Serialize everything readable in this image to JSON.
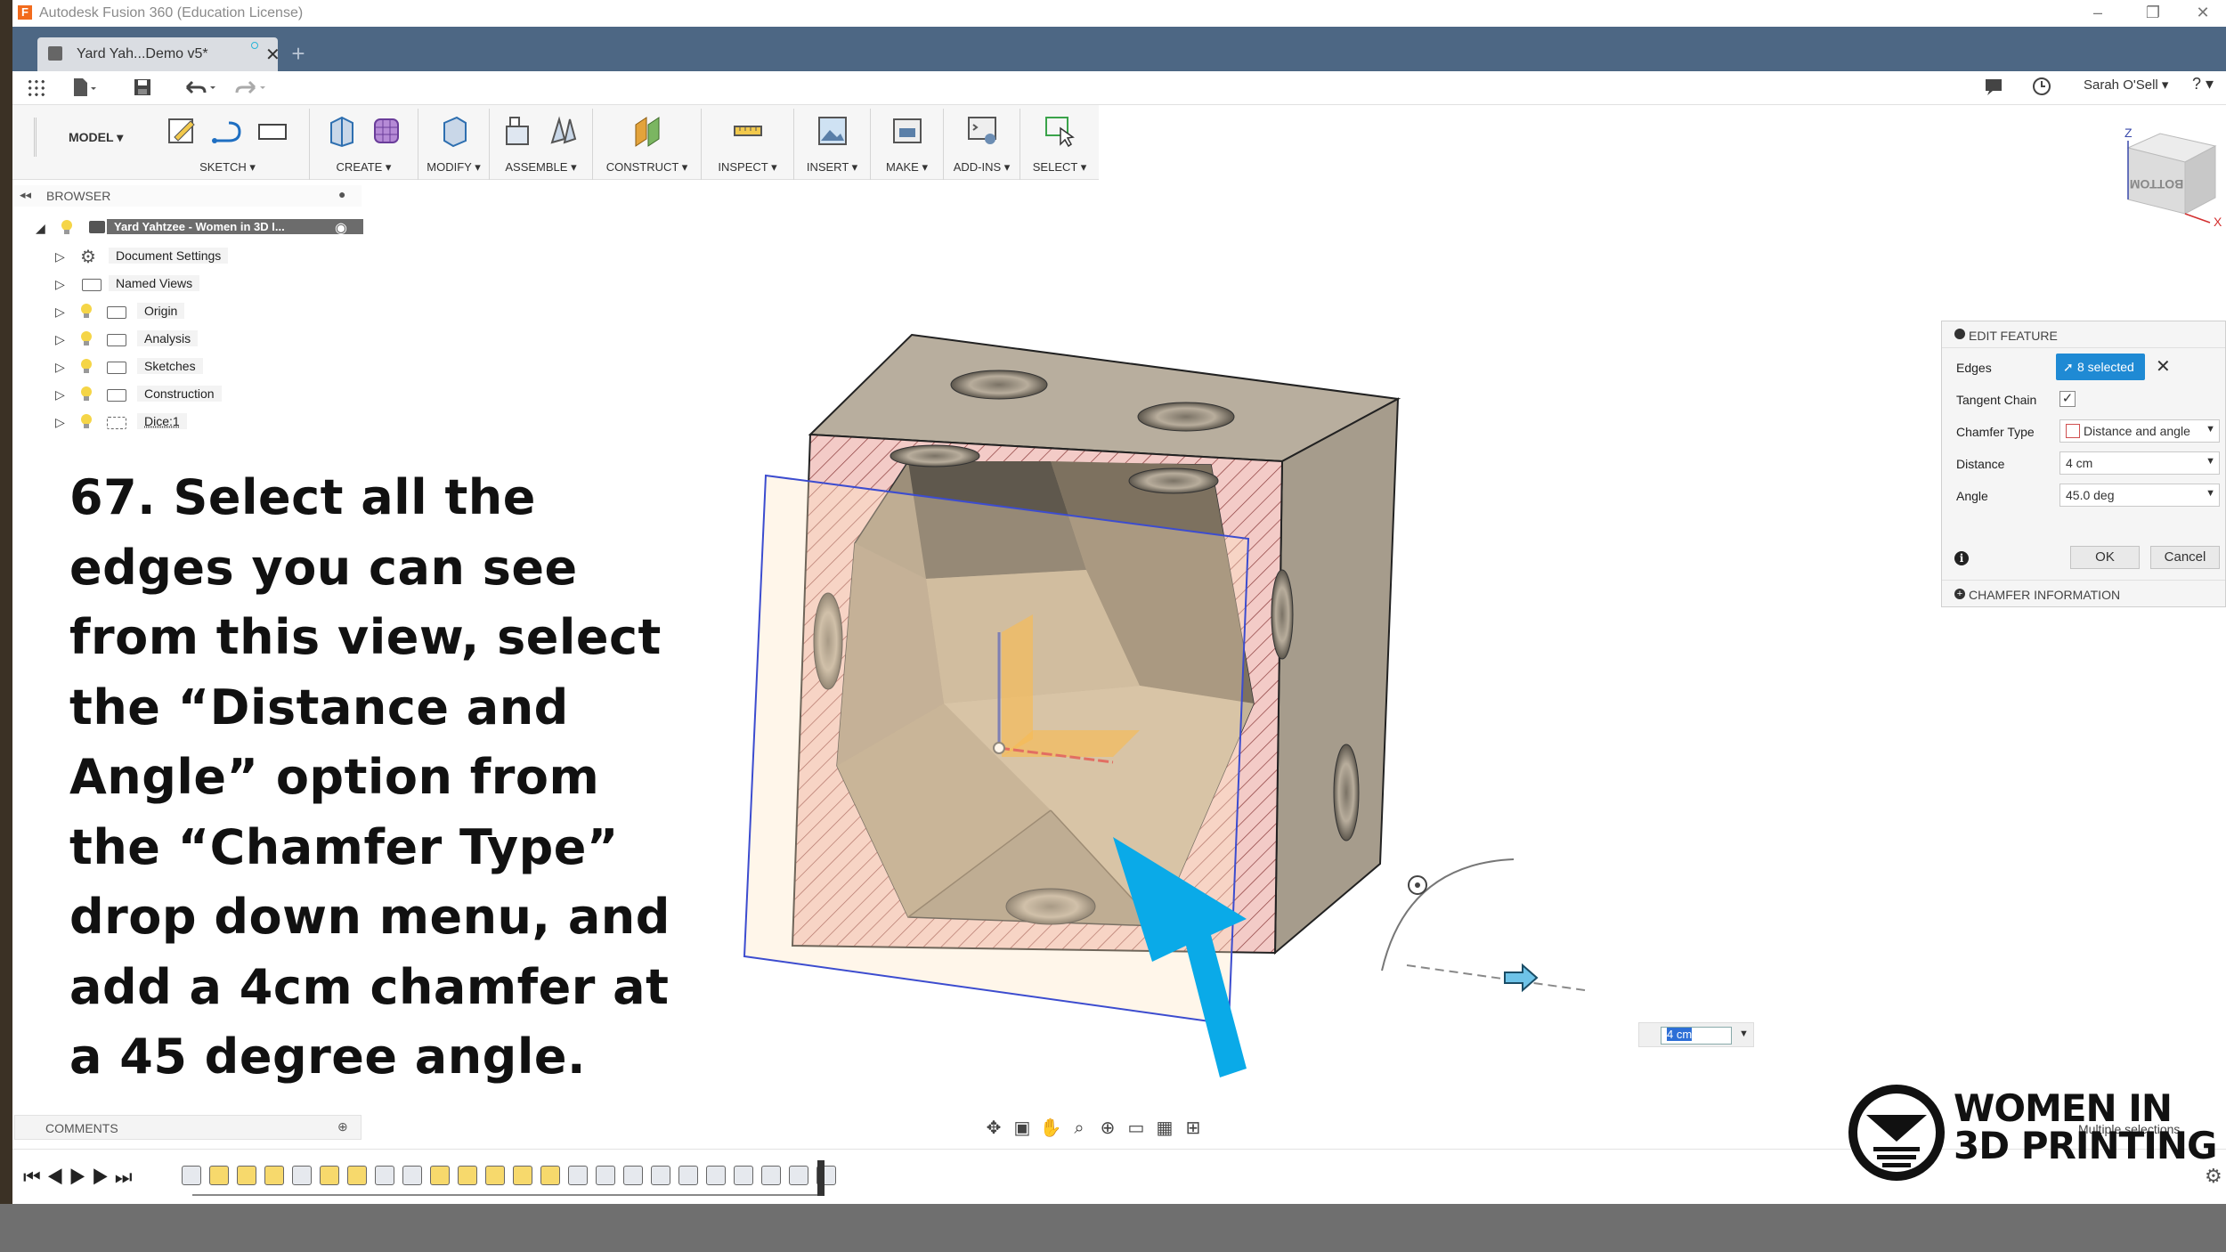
{
  "window": {
    "title": "Autodesk Fusion 360 (Education License)",
    "app_icon_letter": "F",
    "controls": [
      "–",
      "❐",
      "✕"
    ]
  },
  "tabs": {
    "active": {
      "label": "Yard Yah...Demo v5*",
      "close": "✕"
    },
    "new_tab": "+"
  },
  "user": {
    "name": "Sarah O'Sell ▾",
    "help": "? ▾"
  },
  "toolbar": {
    "workspace": "MODEL ▾",
    "groups": [
      "SKETCH ▾",
      "CREATE ▾",
      "MODIFY ▾",
      "ASSEMBLE ▾",
      "CONSTRUCT ▾",
      "INSPECT ▾",
      "INSERT ▾",
      "MAKE ▾",
      "ADD-INS ▾",
      "SELECT ▾"
    ]
  },
  "browser": {
    "header": "BROWSER",
    "root": "Yard Yahtzee - Women in 3D I...",
    "items": [
      "Document Settings",
      "Named Views",
      "Origin",
      "Analysis",
      "Sketches",
      "Construction",
      "Dice:1"
    ]
  },
  "instruction": {
    "text": "67. Select all the edges you can see from this view, select the “Distance and Angle” option from the “Chamfer Type” drop down menu, and add a 4cm chamfer at a 45 degree angle."
  },
  "viewcube": {
    "face_label": "BOTTOM",
    "axis_z": "Z",
    "axis_x": "X"
  },
  "edit_feature": {
    "title": "EDIT FEATURE",
    "edges_label": "Edges",
    "edges_value": "8 selected",
    "tangent_chain_label": "Tangent Chain",
    "tangent_chain_checked": "✓",
    "chamfer_type_label": "Chamfer Type",
    "chamfer_type_value": "Distance and angle",
    "distance_label": "Distance",
    "distance_value": "4 cm",
    "angle_label": "Angle",
    "angle_value": "45.0 deg",
    "ok": "OK",
    "cancel": "Cancel",
    "info_section": "CHAMFER INFORMATION"
  },
  "dimension_input": {
    "value": "4 cm"
  },
  "comments": {
    "label": "COMMENTS"
  },
  "status": {
    "multi_selection": "Multiple selections"
  },
  "logo": {
    "line1": "WOMEN IN",
    "line2": "3D PRINTING"
  },
  "colors": {
    "tab_bar": "#4d6784",
    "selection_blue": "#1f8ad4",
    "arrow_blue": "#0aaae8",
    "section_hatch": "#f2c7c4",
    "body_tan": "#b2a795"
  }
}
